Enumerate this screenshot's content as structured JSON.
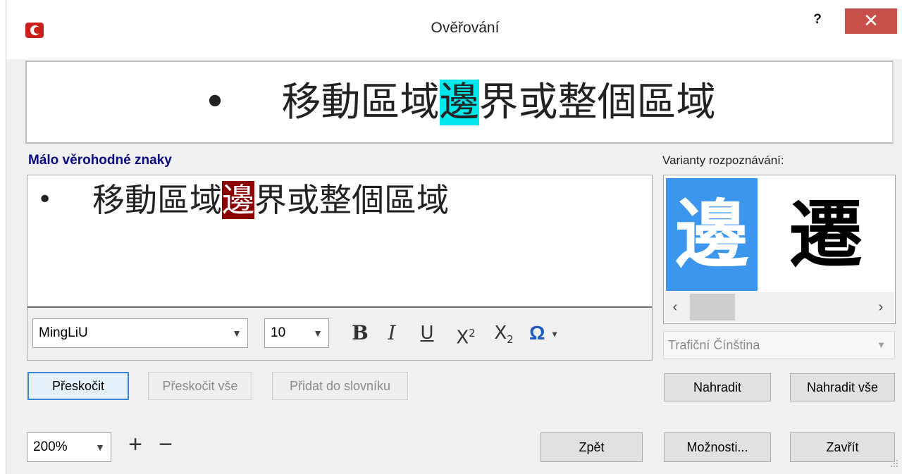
{
  "window": {
    "title": "Ověřování",
    "help_label": "?",
    "close_label": "✕",
    "accent_color": "#c7504a"
  },
  "preview": {
    "bullet": "•",
    "text_before": "移動區域",
    "text_highlight": "邊",
    "text_after": "界或整個區域",
    "highlight_color": "#00e8ec"
  },
  "low_confidence": {
    "label": "Málo věrohodné znaky",
    "bullet": "•",
    "text_before": "移動區域",
    "text_error": "邊",
    "text_after": "界或整個區域",
    "error_color": "#8b0000"
  },
  "format_toolbar": {
    "font": "MingLiU",
    "size": "10",
    "bold": "B",
    "italic": "I",
    "underline": "U",
    "superscript": "X",
    "superscript_mark": "2",
    "subscript": "X",
    "subscript_mark": "2",
    "symbol": "Ω"
  },
  "buttons": {
    "skip": "Přeskočit",
    "skip_all": "Přeskočit vše",
    "add_to_dictionary": "Přidat do slovníku",
    "replace": "Nahradit",
    "replace_all": "Nahradit vše",
    "back": "Zpět",
    "options": "Možnosti...",
    "close": "Zavřít"
  },
  "zoom": {
    "value": "200%",
    "plus": "+",
    "minus": "−"
  },
  "variants": {
    "label": "Varianty rozpoznávání:",
    "items": [
      "邊",
      "遷"
    ],
    "selected_color": "#3d96ee",
    "language": "Trafiční Čínština"
  }
}
